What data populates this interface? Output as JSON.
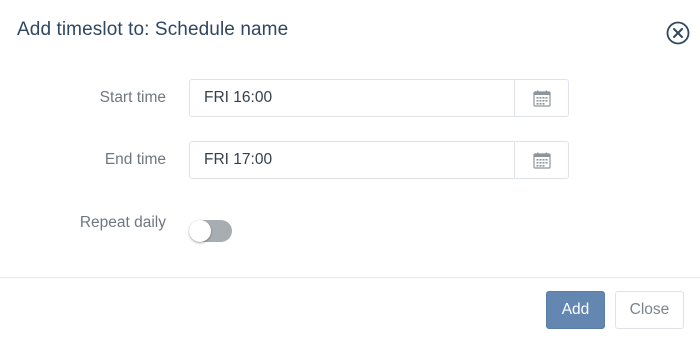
{
  "dialog": {
    "title": "Add timeslot to: Schedule name",
    "close_icon": "close-circle-icon"
  },
  "form": {
    "start_time": {
      "label": "Start time",
      "value": "FRI 16:00",
      "icon": "calendar-icon"
    },
    "end_time": {
      "label": "End time",
      "value": "FRI 17:00",
      "icon": "calendar-icon"
    },
    "repeat_daily": {
      "label": "Repeat daily",
      "checked": false
    }
  },
  "footer": {
    "add_label": "Add",
    "close_label": "Close"
  },
  "colors": {
    "title": "#2f4860",
    "primary_button": "#6387b0",
    "toggle_off": "#a8adb2"
  }
}
